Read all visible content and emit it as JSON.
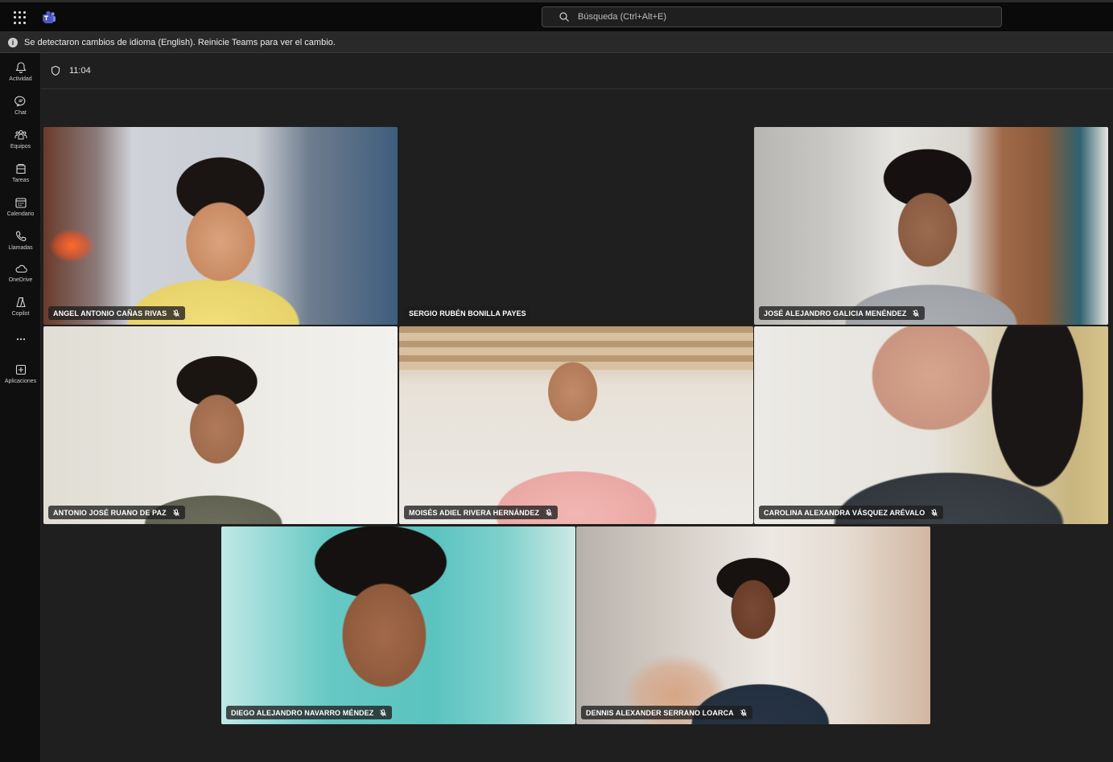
{
  "search": {
    "placeholder": "Búsqueda (Ctrl+Alt+E)"
  },
  "notice": {
    "text": "Se detectaron cambios de idioma (English). Reinicie Teams para ver el cambio."
  },
  "rail": {
    "items": [
      {
        "label": "Actividad",
        "icon": "bell-icon"
      },
      {
        "label": "Chat",
        "icon": "chat-icon"
      },
      {
        "label": "Equipos",
        "icon": "teams-icon"
      },
      {
        "label": "Tareas",
        "icon": "tasks-icon"
      },
      {
        "label": "Calendario",
        "icon": "calendar-icon"
      },
      {
        "label": "Llamadas",
        "icon": "phone-icon"
      },
      {
        "label": "OneDrive",
        "icon": "cloud-icon"
      },
      {
        "label": "Copilot",
        "icon": "copilot-icon"
      },
      {
        "label": "",
        "icon": "more-icon"
      },
      {
        "label": "Aplicaciones",
        "icon": "apps-icon"
      }
    ]
  },
  "meeting": {
    "time": "11:04"
  },
  "participants": [
    {
      "name": "ANGEL ANTONIO CAÑAS RIVAS",
      "muted": true
    },
    {
      "name": "SERGIO RUBÉN BONILLA PAYES",
      "muted": false
    },
    {
      "name": "JOSÉ ALEJANDRO GALICIA MENÉNDEZ",
      "muted": true
    },
    {
      "name": "ANTONIO JOSÉ RUANO DE PAZ",
      "muted": true
    },
    {
      "name": "MOISÉS ADIEL RIVERA HERNÁNDEZ",
      "muted": true
    },
    {
      "name": "CAROLINA ALEXANDRA VÁSQUEZ ARÉVALO",
      "muted": true
    },
    {
      "name": "DIEGO ALEJANDRO NAVARRO MÉNDEZ",
      "muted": true
    },
    {
      "name": "DENNIS ALEXANDER SERRANO LOARCA",
      "muted": true
    }
  ],
  "colors": {
    "background": "#1f1f1f",
    "titlebar": "#0a0a0a",
    "rail": "#0f0f0f",
    "accent": "#5b5fc7"
  }
}
